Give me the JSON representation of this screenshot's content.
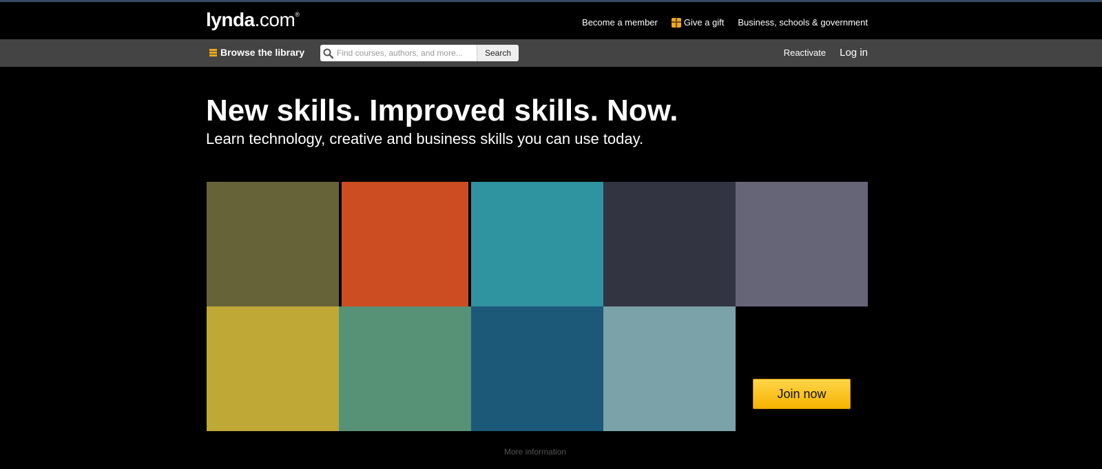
{
  "brand": {
    "logo_bold": "lynda",
    "logo_light": ".com",
    "logo_mark": "®"
  },
  "top_links": {
    "become_member": "Become a member",
    "give_gift": "Give a gift",
    "business": "Business, schools & government"
  },
  "nav": {
    "browse_label": "Browse the library",
    "search_placeholder": "Find courses, authors, and more...",
    "search_button": "Search",
    "reactivate": "Reactivate",
    "login": "Log in"
  },
  "hero": {
    "title": "New skills. Improved skills. Now.",
    "subtitle": "Learn technology, creative and business skills you can use today."
  },
  "tiles": {
    "colors": [
      "#676339",
      "#cc4d22",
      "#3093a0",
      "#333442",
      "#666578",
      "#c0a836",
      "#589276",
      "#1c5877",
      "#7ba2a8"
    ]
  },
  "cta": {
    "join_label": "Join now",
    "more_info": "More information"
  },
  "colors": {
    "accent": "#f0a81c",
    "nav_bg": "#444444",
    "join_button": "#f5b400"
  },
  "icons": [
    "menu-icon",
    "search-icon",
    "gift-icon"
  ]
}
